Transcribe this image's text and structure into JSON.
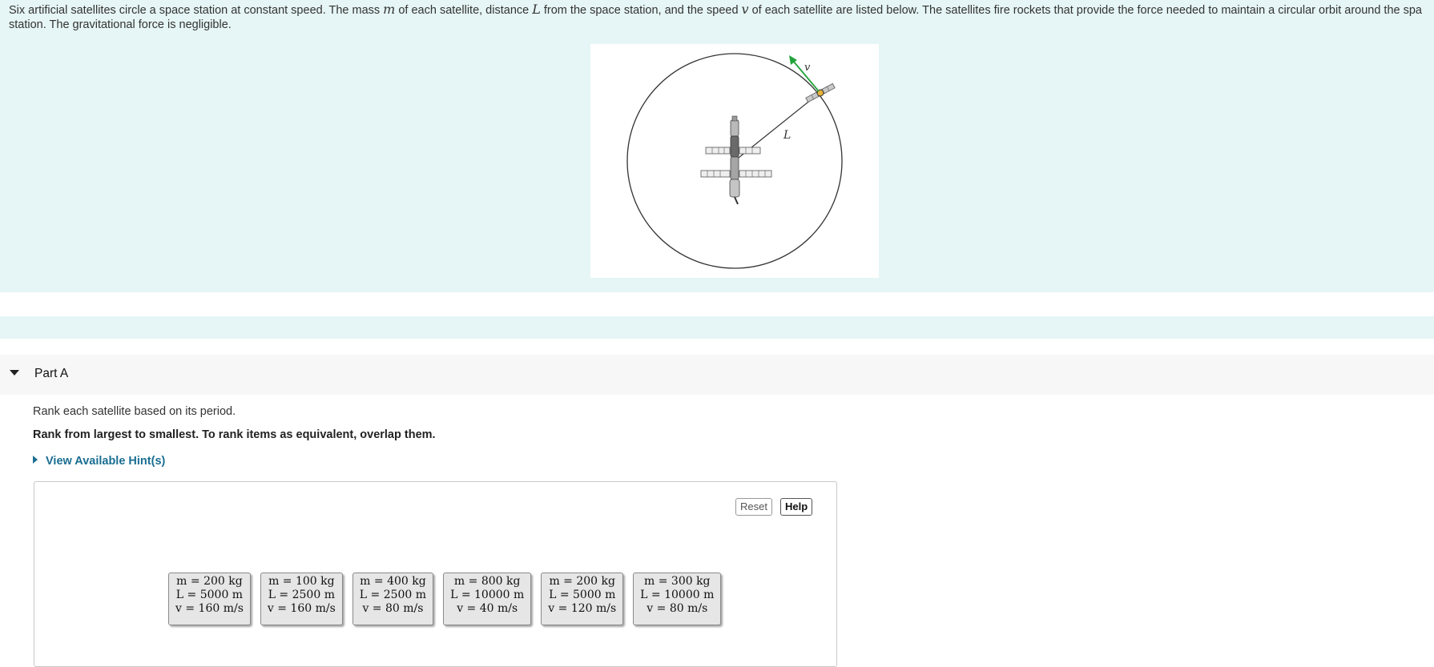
{
  "intro": {
    "line1_a": "Six artificial satellites circle a space station at constant speed. The mass ",
    "sym_m": "m",
    "line1_b": " of each satellite, distance ",
    "sym_L": "L",
    "line1_c": " from the space station, and the speed ",
    "sym_v": "v",
    "line1_d": " of each satellite are listed below. The satellites fire rockets that provide the force needed to maintain a circular orbit around the spa",
    "line2": "station. The gravitational force is negligible."
  },
  "figure": {
    "label_v": "v",
    "label_L": "L",
    "velocity_color": "#22a33a"
  },
  "part": {
    "title": "Part A",
    "prompt": "Rank each satellite based on its period.",
    "instruction": "Rank from largest to smallest. To rank items as equivalent, overlap them.",
    "hint_link": "View Available Hint(s)",
    "reset_label": "Reset",
    "help_label": "Help"
  },
  "tiles": [
    {
      "m": "m = 200 kg",
      "L": "L = 5000 m",
      "v": "v = 160 m/s"
    },
    {
      "m": "m = 100 kg",
      "L": "L = 2500 m",
      "v": "v = 160 m/s"
    },
    {
      "m": "m = 400 kg",
      "L": "L = 2500 m",
      "v": "v = 80 m/s"
    },
    {
      "m": "m = 800 kg",
      "L": "L = 10000 m",
      "v": "v = 40 m/s"
    },
    {
      "m": "m = 200 kg",
      "L": "L = 5000 m",
      "v": "v = 120 m/s"
    },
    {
      "m": "m = 300 kg",
      "L": "L = 10000 m",
      "v": "v = 80 m/s"
    }
  ]
}
